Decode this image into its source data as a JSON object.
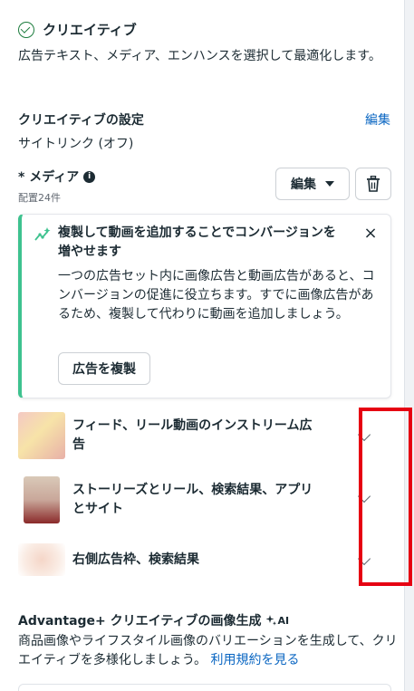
{
  "section": {
    "title": "クリエイティブ",
    "description": "広告テキスト、メディア、エンハンスを選択して最適化します。"
  },
  "settings": {
    "title": "クリエイティブの設定",
    "edit_label": "編集",
    "value": "サイトリンク (オフ)"
  },
  "media": {
    "title": "* メディア",
    "info_icon": "i",
    "subtitle": "配置24件",
    "edit_button_label": "編集"
  },
  "tip": {
    "title": "複製して動画を追加することでコンバージョンを増やせます",
    "close_icon": "×",
    "body": "一つの広告セット内に画像広告と動画広告があると、コンバージョンの促進に役立ちます。すでに画像広告があるため、複製して代わりに動画を追加しましょう。",
    "button_label": "広告を複製"
  },
  "placements": [
    {
      "label": "フィード、リール動画のインストリーム広告"
    },
    {
      "label": "ストーリーズとリール、検索結果、アプリとサイト"
    },
    {
      "label": "右側広告枠、検索結果"
    }
  ],
  "advantage": {
    "title": "Advantage+ クリエイティブの画像生成",
    "ai_label": "AI",
    "description": "商品画像やライフスタイル画像のバリエーションを生成して、クリエイティブを多様化しましょう。",
    "link_label": "利用規約を見る"
  },
  "colors": {
    "link": "#0a66c2",
    "tip_accent": "#3ec28f",
    "highlight": "#e60012",
    "success": "#1c7c3d"
  }
}
